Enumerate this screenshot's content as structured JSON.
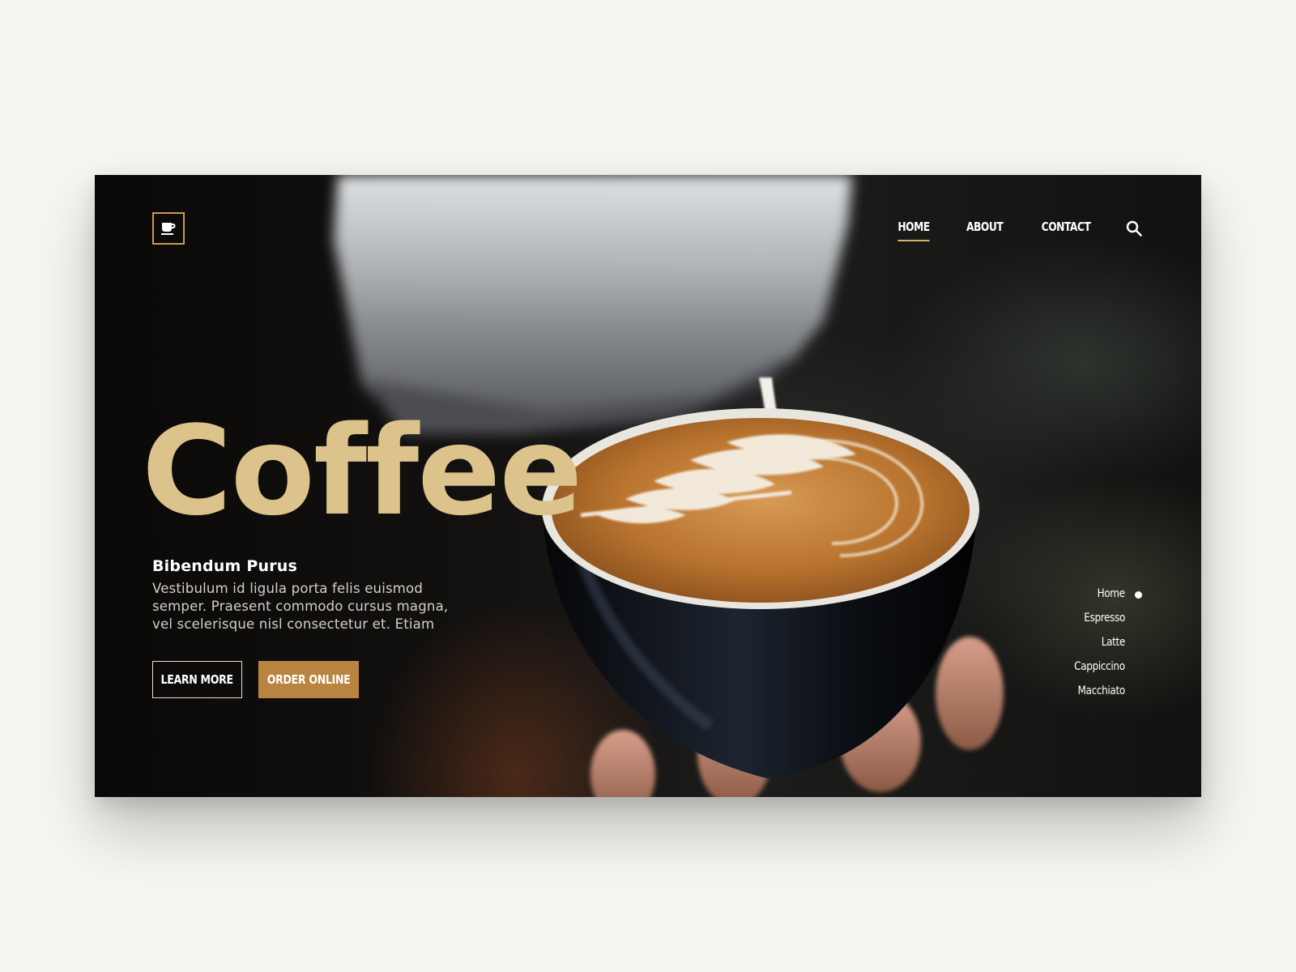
{
  "brand": {
    "logo_icon": "coffee-cup-icon",
    "accent": "#dcc28b",
    "button_fill": "#b8843f"
  },
  "nav": {
    "items": [
      {
        "label": "HOME",
        "active": true
      },
      {
        "label": "ABOUT",
        "active": false
      },
      {
        "label": "CONTACT",
        "active": false
      }
    ],
    "search_icon": "search-icon"
  },
  "hero": {
    "title": "Coffee",
    "subtitle": "Bibendum Purus",
    "body": "Vestibulum id ligula porta felis euismod semper. Praesent commodo cursus magna, vel scelerisque nisl consectetur et. Etiam",
    "primary_button": "LEARN MORE",
    "secondary_button": "ORDER ONLINE"
  },
  "side_menu": {
    "items": [
      "Home",
      "Espresso",
      "Latte",
      "Cappiccino",
      "Macchiato"
    ],
    "active_index": 0
  }
}
